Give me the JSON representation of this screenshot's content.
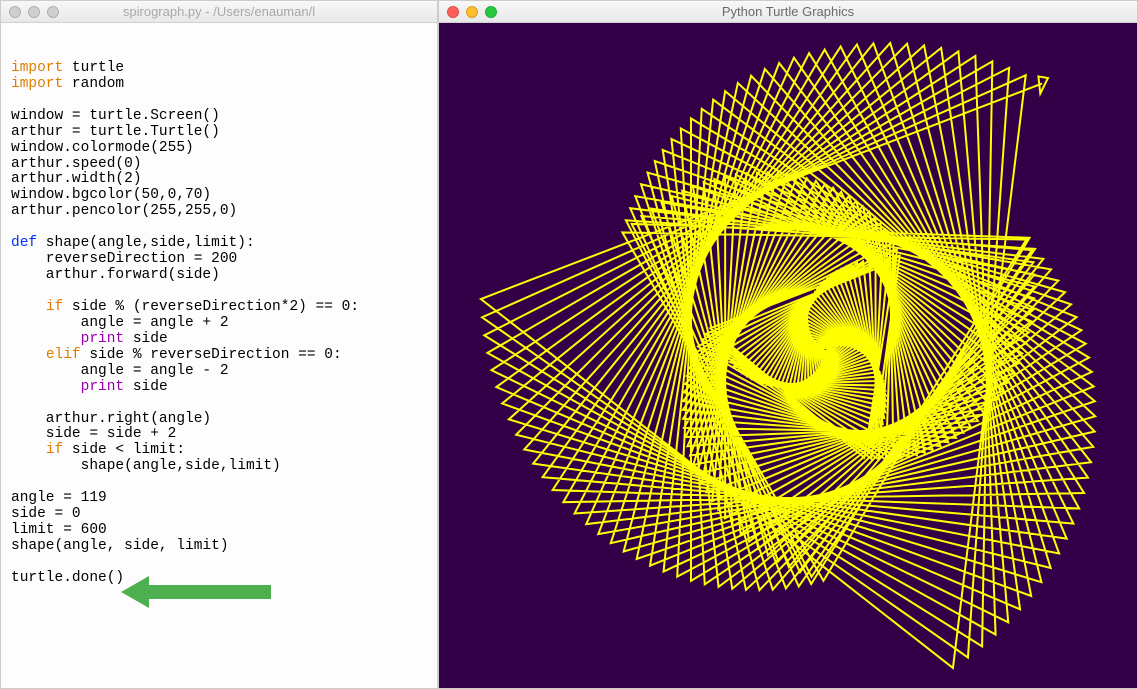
{
  "editor": {
    "title": "spirograph.py - /Users/enauman/l",
    "code": {
      "lines": [
        [
          [
            "import",
            "kw1"
          ],
          [
            " turtle",
            "plain"
          ]
        ],
        [
          [
            "import",
            "kw1"
          ],
          [
            " random",
            "plain"
          ]
        ],
        [
          [
            "",
            "plain"
          ]
        ],
        [
          [
            "window = turtle.Screen()",
            "plain"
          ]
        ],
        [
          [
            "arthur = turtle.Turtle()",
            "plain"
          ]
        ],
        [
          [
            "window.colormode(255)",
            "plain"
          ]
        ],
        [
          [
            "arthur.speed(0)",
            "plain"
          ]
        ],
        [
          [
            "arthur.width(2)",
            "plain"
          ]
        ],
        [
          [
            "window.bgcolor(50,0,70)",
            "plain"
          ]
        ],
        [
          [
            "arthur.pencolor(255,255,0)",
            "plain"
          ]
        ],
        [
          [
            "",
            "plain"
          ]
        ],
        [
          [
            "def",
            "kw2"
          ],
          [
            " shape(angle,side,limit):",
            "plain"
          ]
        ],
        [
          [
            "    reverseDirection = 200",
            "plain"
          ]
        ],
        [
          [
            "    arthur.forward(side)",
            "plain"
          ]
        ],
        [
          [
            "",
            "plain"
          ]
        ],
        [
          [
            "    ",
            "plain"
          ],
          [
            "if",
            "kw3"
          ],
          [
            " side % (reverseDirection*2) == 0:",
            "plain"
          ]
        ],
        [
          [
            "        angle = angle + 2",
            "plain"
          ]
        ],
        [
          [
            "        ",
            "plain"
          ],
          [
            "print",
            "kw4"
          ],
          [
            " side",
            "plain"
          ]
        ],
        [
          [
            "    ",
            "plain"
          ],
          [
            "elif",
            "kw3"
          ],
          [
            " side % reverseDirection == 0:",
            "plain"
          ]
        ],
        [
          [
            "        angle = angle - 2",
            "plain"
          ]
        ],
        [
          [
            "        ",
            "plain"
          ],
          [
            "print",
            "kw4"
          ],
          [
            " side",
            "plain"
          ]
        ],
        [
          [
            "",
            "plain"
          ]
        ],
        [
          [
            "    arthur.right(angle)",
            "plain"
          ]
        ],
        [
          [
            "    side = side + 2",
            "plain"
          ]
        ],
        [
          [
            "    ",
            "plain"
          ],
          [
            "if",
            "kw3"
          ],
          [
            " side < limit:",
            "plain"
          ]
        ],
        [
          [
            "        shape(angle,side,limit)",
            "plain"
          ]
        ],
        [
          [
            "",
            "plain"
          ]
        ],
        [
          [
            "angle = 119",
            "plain"
          ]
        ],
        [
          [
            "side = 0",
            "plain"
          ]
        ],
        [
          [
            "limit = 600",
            "plain"
          ]
        ],
        [
          [
            "shape(angle, side, limit)",
            "plain"
          ]
        ],
        [
          [
            "",
            "plain"
          ]
        ],
        [
          [
            "turtle.done()",
            "plain"
          ]
        ]
      ]
    }
  },
  "turtle_window": {
    "title": "Python Turtle Graphics",
    "bgcolor": "#320046",
    "pencolor": "#ffff00",
    "penwidth": 2
  },
  "turtle_params": {
    "angle": 119,
    "side": 0,
    "limit": 600,
    "reverseDirection": 200
  },
  "annotation": {
    "arrow_color": "#4caf50",
    "arrow_target_line": "angle = 119"
  }
}
